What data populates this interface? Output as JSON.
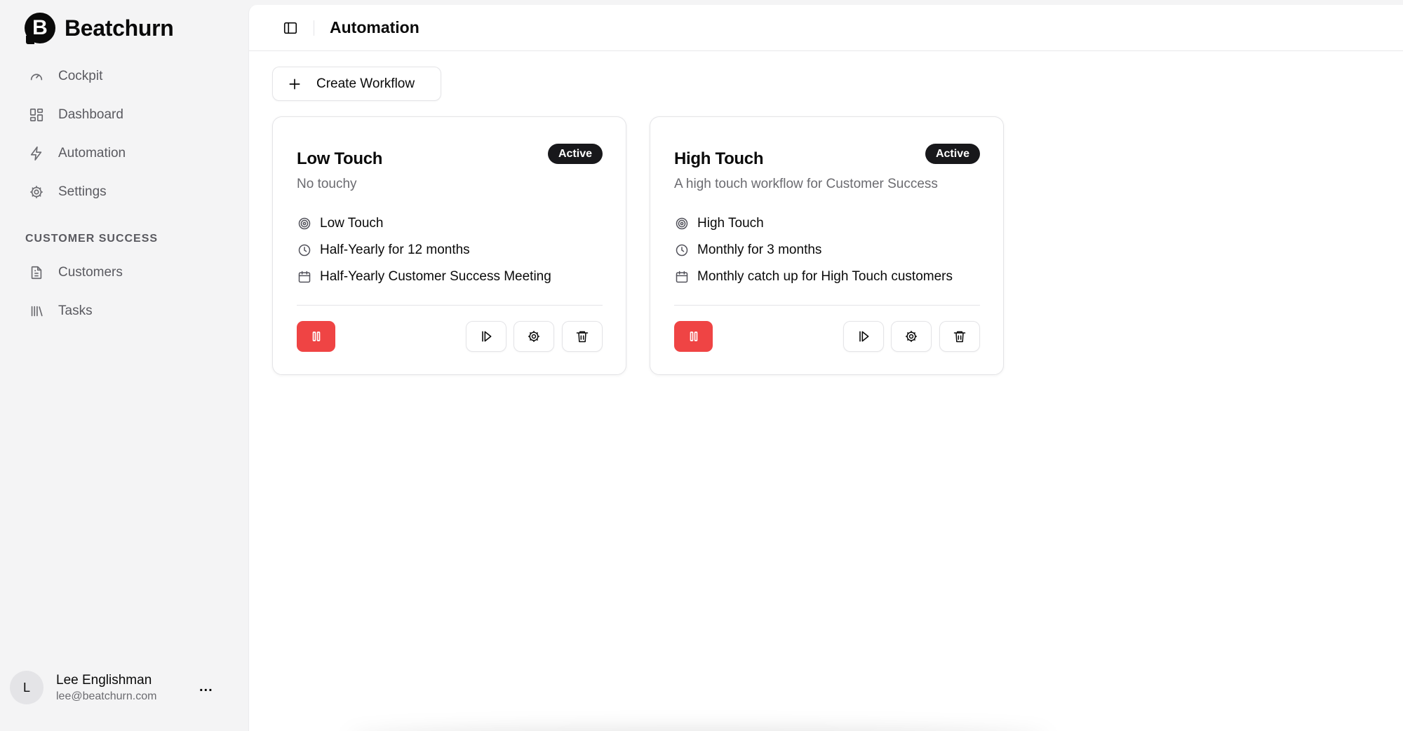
{
  "brand": {
    "logo_letter": "B",
    "name": "Beatchurn"
  },
  "sidebar": {
    "main_items": [
      {
        "label": "Cockpit",
        "icon": "gauge-icon"
      },
      {
        "label": "Dashboard",
        "icon": "layout-grid-icon"
      },
      {
        "label": "Automation",
        "icon": "zap-icon"
      },
      {
        "label": "Settings",
        "icon": "gear-icon"
      }
    ],
    "section_label": "CUSTOMER SUCCESS",
    "section_items": [
      {
        "label": "Customers",
        "icon": "file-text-icon"
      },
      {
        "label": "Tasks",
        "icon": "library-icon"
      }
    ]
  },
  "user": {
    "initial": "L",
    "name": "Lee Englishman",
    "email": "lee@beatchurn.com",
    "more_label": "..."
  },
  "header": {
    "title": "Automation"
  },
  "toolbar": {
    "create_label": "Create Workflow"
  },
  "workflows": [
    {
      "title": "Low Touch",
      "status": "Active",
      "description": "No touchy",
      "segment": "Low Touch",
      "schedule": "Half-Yearly for 12 months",
      "meeting": "Half-Yearly Customer Success Meeting"
    },
    {
      "title": "High Touch",
      "status": "Active",
      "description": "A high touch workflow for Customer Success",
      "segment": "High Touch",
      "schedule": "Monthly for 3 months",
      "meeting": "Monthly catch up for High Touch customers"
    }
  ],
  "colors": {
    "pause_button": "#ef4444",
    "badge_bg": "#18181b",
    "sidebar_bg": "#f4f4f5",
    "main_bg": "#ffffff"
  }
}
